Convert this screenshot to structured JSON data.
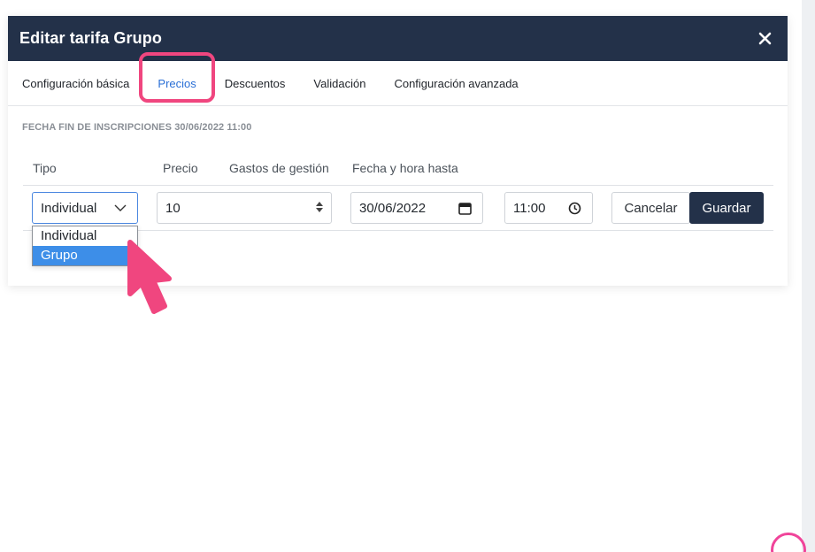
{
  "modal": {
    "title": "Editar tarifa Grupo",
    "close_icon": "close-icon"
  },
  "tabs": [
    {
      "label": "Configuración básica",
      "active": false
    },
    {
      "label": "Precios",
      "active": true
    },
    {
      "label": "Descuentos",
      "active": false
    },
    {
      "label": "Validación",
      "active": false
    },
    {
      "label": "Configuración avanzada",
      "active": false
    }
  ],
  "section_label": "FECHA FIN DE INSCRIPCIONES 30/06/2022 11:00",
  "columns": [
    "Tipo",
    "Precio",
    "Gastos de gestión",
    "Fecha y hora hasta"
  ],
  "row": {
    "tipo_value": "Individual",
    "precio_value": "10",
    "date_value": "30/06/2022",
    "time_value": "11:00"
  },
  "dropdown": {
    "options": [
      "Individual",
      "Grupo"
    ],
    "highlighted": "Grupo"
  },
  "buttons": {
    "cancel": "Cancelar",
    "save": "Guardar"
  },
  "colors": {
    "header_bg": "#233149",
    "active_tab": "#2a6fd6",
    "highlight": "#f0467f",
    "option_selected": "#3d8ee8"
  }
}
